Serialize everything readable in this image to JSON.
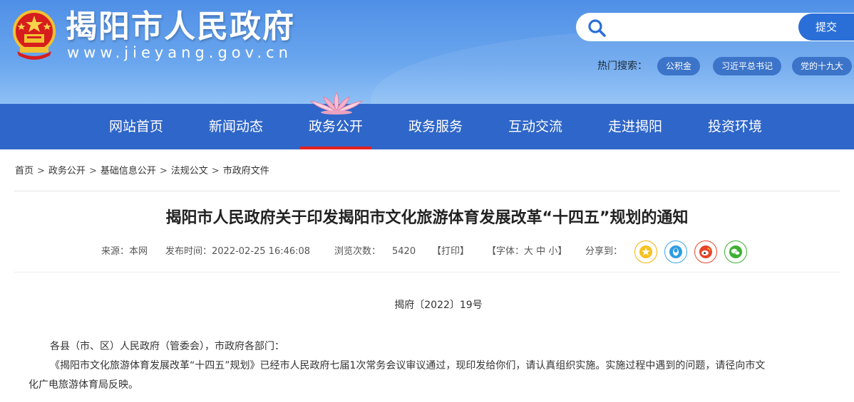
{
  "header": {
    "site_title": "揭阳市人民政府",
    "site_domain": "www.jieyang.gov.cn",
    "search_placeholder": "",
    "submit_label": "提交",
    "hot_label": "热门搜索：",
    "hot_tags": [
      "公积金",
      "习近平总书记",
      "党的十九大"
    ]
  },
  "nav": {
    "items": [
      "网站首页",
      "新闻动态",
      "政务公开",
      "政务服务",
      "互动交流",
      "走进揭阳",
      "投资环境"
    ],
    "active": "政务公开"
  },
  "breadcrumb": [
    "首页",
    "政务公开",
    "基础信息公开",
    "法规公文",
    "市政府文件"
  ],
  "breadcrumb_sep": ">",
  "article": {
    "title": "揭阳市人民政府关于印发揭阳市文化旅游体育发展改革“十四五”规划的通知",
    "meta": {
      "source": "来源：本网",
      "published": "发布时间：2022-02-25 16:46:08",
      "views_label": "浏览次数：",
      "views": "5420",
      "print": "【打印】",
      "font_label": "【字体：",
      "font_large": "大",
      "font_medium": "中",
      "font_small": "小",
      "font_close": "】",
      "share_label": "分享到："
    },
    "share": [
      {
        "name": "qzone-icon",
        "color": "#f0b400"
      },
      {
        "name": "qq-icon",
        "color": "#3ba6e8"
      },
      {
        "name": "weibo-icon",
        "color": "#e8452c"
      },
      {
        "name": "wechat-icon",
        "color": "#3cb034"
      }
    ],
    "doc_number": "揭府〔2022〕19号",
    "salutation": "各县（市、区）人民政府（管委会），市政府各部门：",
    "body_line1": "《揭阳市文化旅游体育发展改革“十四五”规划》已经市人民政府七届1次常务会议审议通过，现印发给你们，请认真组织实施。实施过程中遇到的问题，请径向市文",
    "body_line2": "化广电旅游体育局反映。"
  },
  "colors": {
    "header_blue": "#5b9aea",
    "nav_blue": "#2f66c9",
    "active_underline": "#e61f1f",
    "submit_blue": "#2a6fd8",
    "tag_blue": "#3b74c8"
  }
}
